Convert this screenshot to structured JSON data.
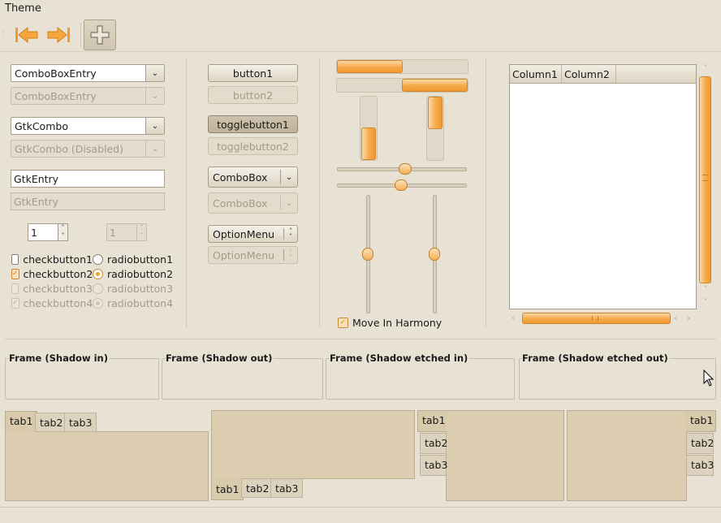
{
  "menubar": {
    "theme_menu": "Theme"
  },
  "toolbar": {
    "back_icon": "arrow-left-icon",
    "forward_icon": "arrow-right-icon",
    "add_icon": "plus-icon"
  },
  "left": {
    "combo_entry_1": "ComboBoxEntry",
    "combo_entry_2": "ComboBoxEntry",
    "gtk_combo_1": "GtkCombo",
    "gtk_combo_2": "GtkCombo (Disabled)",
    "entry_1": "GtkEntry",
    "entry_2": "GtkEntry",
    "spin_1": "1",
    "spin_2": "1",
    "checks": [
      "checkbutton1",
      "checkbutton2",
      "checkbutton3",
      "checkbutton4"
    ],
    "radios": [
      "radiobutton1",
      "radiobutton2",
      "radiobutton3",
      "radiobutton4"
    ]
  },
  "middle": {
    "button1": "button1",
    "button2": "button2",
    "toggle1": "togglebutton1",
    "toggle2": "togglebutton2",
    "combobox1": "ComboBox",
    "combobox2": "ComboBox",
    "optmenu1": "OptionMenu",
    "optmenu2": "OptionMenu"
  },
  "sliders": {
    "harmony_label": "Move In Harmony"
  },
  "tree": {
    "col1": "Column1",
    "col2": "Column2"
  },
  "frames": [
    "Frame (Shadow in)",
    "Frame (Shadow out)",
    "Frame (Shadow etched in)",
    "Frame (Shadow etched out)"
  ],
  "notebooks": {
    "nb1": [
      "tab1",
      "tab2",
      "tab3"
    ],
    "nb2": [
      "tab1",
      "tab2",
      "tab3"
    ],
    "nb3": [
      "tab1",
      "tab2",
      "tab3"
    ],
    "nb4": [
      "tab1",
      "tab2",
      "tab3"
    ]
  }
}
